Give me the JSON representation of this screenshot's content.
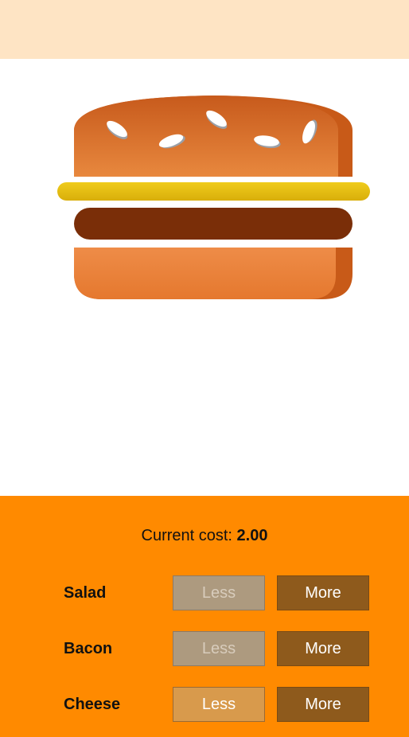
{
  "cost": {
    "label": "Current cost: ",
    "value": "2.00"
  },
  "ingredients": [
    {
      "label": "Salad",
      "less_label": "Less",
      "more_label": "More",
      "less_enabled": false
    },
    {
      "label": "Bacon",
      "less_label": "Less",
      "more_label": "More",
      "less_enabled": false
    },
    {
      "label": "Cheese",
      "less_label": "Less",
      "more_label": "More",
      "less_enabled": true
    }
  ],
  "colors": {
    "top_bar": "#fee4c4",
    "controls_background": "#ff8a00",
    "button_more": "#8e5a1c",
    "button_less_disabled": "#ad9a7f",
    "button_less_enabled": "#d89a4c",
    "bun": "#e07a30",
    "cheese": "#e8c010",
    "patty": "#7a2e08"
  }
}
